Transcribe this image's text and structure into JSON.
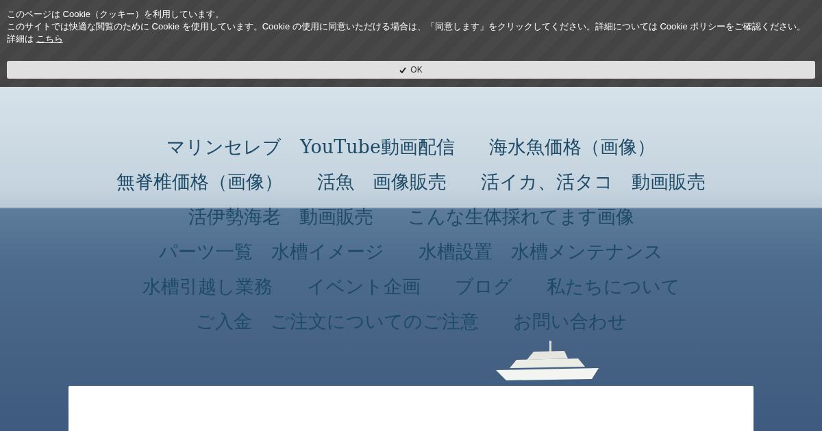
{
  "cookie_banner": {
    "title": "このページは Cookie（クッキー）を利用しています。",
    "message": "このサイトでは快適な閲覧のために Cookie を使用しています。Cookie の使用に同意いただける場合は、「同意します」をクリックしてください。詳細については Cookie ポリシーをご確認ください。",
    "details_label": "詳細は",
    "details_link": "こちら",
    "ok_button": "OK"
  },
  "nav": {
    "rows": [
      [
        "マリンセレブ　YouTube動画配信",
        "海水魚価格（画像）"
      ],
      [
        "無脊椎価格（画像）",
        "活魚　画像販売",
        "活イカ、活タコ　動画販売"
      ],
      [
        "活伊勢海老　動画販売",
        "こんな生体採れてます画像"
      ],
      [
        "パーツ一覧　水槽イメージ",
        "水槽設置　水槽メンテナンス"
      ],
      [
        "水槽引越し業務",
        "イベント企画",
        "ブログ",
        "私たちについて"
      ],
      [
        "ご入金　ご注文についてのご注意",
        "お問い合わせ"
      ]
    ]
  }
}
